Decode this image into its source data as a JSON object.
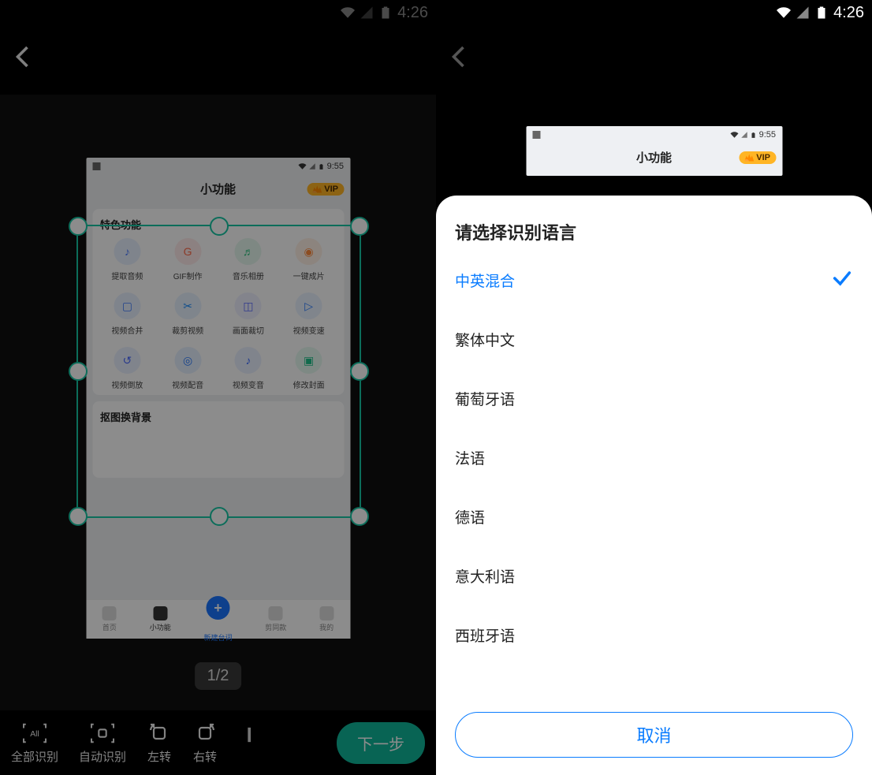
{
  "status": {
    "time": "4:26"
  },
  "left": {
    "inner_status_time": "9:55",
    "inner_title": "小功能",
    "vip_label": "VIP",
    "card1_title": "特色功能",
    "card2_title": "抠图换背景",
    "grid": [
      {
        "label": "提取音频",
        "bg": "#e8f0ff",
        "fg": "#4b7bff",
        "icon": "♪"
      },
      {
        "label": "GIF制作",
        "bg": "#ffeceb",
        "fg": "#ff6b4a",
        "icon": "G"
      },
      {
        "label": "音乐相册",
        "bg": "#e6f8ef",
        "fg": "#2ec27e",
        "icon": "♬"
      },
      {
        "label": "一键成片",
        "bg": "#fff0e6",
        "fg": "#ff8a3d",
        "icon": "◉"
      },
      {
        "label": "视频合并",
        "bg": "#e8f0ff",
        "fg": "#3d7bff",
        "icon": "▢"
      },
      {
        "label": "裁剪视频",
        "bg": "#e8f2ff",
        "fg": "#1a8cff",
        "icon": "✂"
      },
      {
        "label": "画面裁切",
        "bg": "#eef0ff",
        "fg": "#5a6bff",
        "icon": "◫"
      },
      {
        "label": "视频变速",
        "bg": "#eaf2ff",
        "fg": "#2a7bff",
        "icon": "▷"
      },
      {
        "label": "视频倒放",
        "bg": "#eaf0ff",
        "fg": "#4a6bff",
        "icon": "↺"
      },
      {
        "label": "视频配音",
        "bg": "#e6f0ff",
        "fg": "#2a7bff",
        "icon": "◎"
      },
      {
        "label": "视频变音",
        "bg": "#eaf0ff",
        "fg": "#3a6bff",
        "icon": "♪"
      },
      {
        "label": "修改封面",
        "bg": "#e6f9f1",
        "fg": "#1fc28a",
        "icon": "▣"
      }
    ],
    "nav": [
      "首页",
      "小功能",
      "新建台词",
      "剪同款",
      "我的"
    ],
    "nav_selected": 2,
    "page_indicator": "1/2",
    "tools": [
      {
        "label": "全部识别",
        "name": "all-recognize"
      },
      {
        "label": "自动识别",
        "name": "auto-recognize"
      },
      {
        "label": "左转",
        "name": "rotate-left"
      },
      {
        "label": "右转",
        "name": "rotate-right"
      }
    ],
    "next_label": "下一步"
  },
  "right": {
    "sheet_title": "请选择识别语言",
    "languages": [
      "中英混合",
      "繁体中文",
      "葡萄牙语",
      "法语",
      "德语",
      "意大利语",
      "西班牙语"
    ],
    "selected_index": 0,
    "cancel_label": "取消"
  }
}
